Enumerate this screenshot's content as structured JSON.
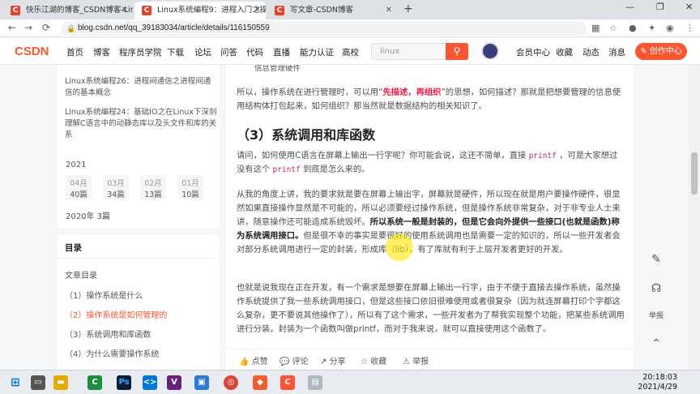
{
  "browser": {
    "tabs": [
      {
        "title": "快乐江湖的博客_CSDN博客-Linu",
        "active": false
      },
      {
        "title": "Linux系统编程9：进程入门之操作",
        "active": true
      },
      {
        "title": "写文章-CSDN博客",
        "active": false
      }
    ],
    "url": "blog.csdn.net/qq_39183034/article/details/116150559"
  },
  "csdn_nav": {
    "logo": "CSDN",
    "items": [
      "首页",
      "博客",
      "程序员学院",
      "下载",
      "论坛",
      "问答",
      "代码",
      "直播",
      "能力认证",
      "高校"
    ],
    "search_placeholder": "linux",
    "right_items": [
      "会员中心",
      "收藏",
      "动态",
      "消息"
    ],
    "create_label": "创作中心"
  },
  "sidebar": {
    "recent": [
      "Linux系统编程26：进程间通信之进程间通信的基本概念",
      "Linux系统编程24：基础IO之在Linux下深刻理解C语言中的动静态库以及头文件和库的关系"
    ],
    "archive_year": "2021",
    "months": [
      {
        "month": "04月",
        "count": "40篇"
      },
      {
        "month": "03月",
        "count": "34篇"
      },
      {
        "month": "02月",
        "count": "13篇"
      },
      {
        "month": "01月",
        "count": "10篇"
      }
    ],
    "archive_2020": "2020年  3篇",
    "toc_title": "目录",
    "toc_sub": "文章目录",
    "toc_items": [
      {
        "label": "（1）操作系统是什么",
        "current": false
      },
      {
        "label": "（2）操作系统是如何管理的",
        "current": true
      },
      {
        "label": "（3）系统调用和库函数",
        "current": false
      },
      {
        "label": "（4）为什么需要操作系统",
        "current": false
      }
    ]
  },
  "article": {
    "top_fragment": "信息管理硬件",
    "p1_a": "所以，操作系统在进行管理时，可以用“",
    "p1_hl": "先描述，再组织",
    "p1_b": "”的思想，如何描述？那就是把想要管理的信息使用结构体打包起来，如何组织？那当然就是数据结构的相关知识了。",
    "heading": "（3）系统调用和库函数",
    "p2_a": "请问，如何使用C语言在屏幕上输出一行字呢？你可能会说，这还不简单，直接 ",
    "p2_code": "printf",
    "p2_b": " ，可是大家想过没有这个 ",
    "p2_c": " 到底是怎么来的。",
    "p3_a": "从我的角度上讲，我的要求就是要在屏幕上输出字，屏幕就是硬件，所以现在就是用户要操作硬件，很显然如果直接操作显然是不可能的，所以必须要经过操作系统，但是操作系统非常复杂，对于非专业人士来讲，随意操作还可能造成系统毁坏。",
    "p3_bold": "所以系统一般是封装的，但是它会向外提供一些接口(也就是函数)称为系统调用接口。",
    "p3_b": "但是很不幸的事实是要很好的使用系统调用也是需要一定的知识的，所以一些开发者会对部分系统调用进行一定的封装，形成库（lib），有了库就有利于上层开发者更好的开发。",
    "p4": "也就是说我现在正在开发，有一个需求是想要在屏幕上输出一行字，由于不便于直接去操作系统，虽然操作系统提供了我一些系统调用接口，但是这些接口依旧很难使用或者很复杂（因为就连屏幕打印个字都这么复杂，更不要说其他操作了），所以有了这个需求，一些开发者为了帮我实现整个功能，把某些系统调用进行分装，封装为一个函数叫做printf，而对于我来说，就可以直接使用这个函数了。",
    "actions": [
      "点赞",
      "评论",
      "分享",
      "收藏",
      "举报"
    ]
  },
  "float_tools": {
    "report_label": "举报"
  },
  "taskbar": {
    "time": "20:18:03",
    "date": "2021/4/29"
  }
}
